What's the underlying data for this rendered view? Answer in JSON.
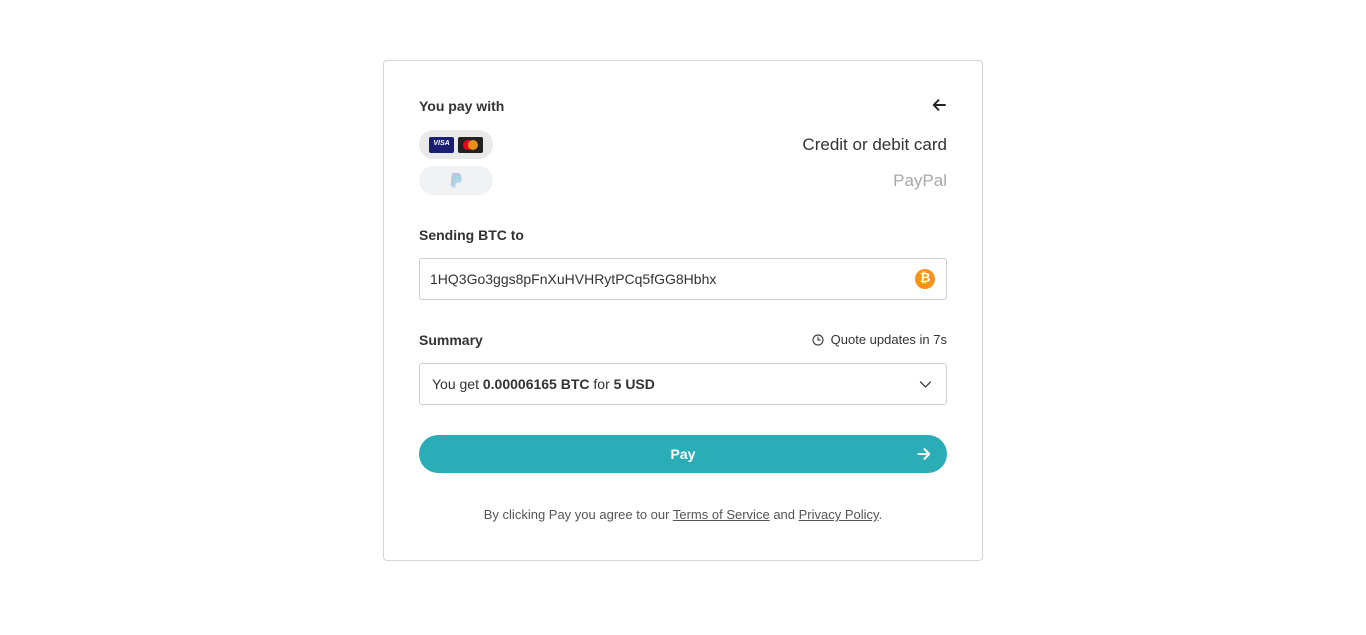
{
  "payment": {
    "title": "You pay with",
    "methods": [
      {
        "label": "Credit or debit card",
        "icons": [
          "visa-icon",
          "mastercard-icon"
        ],
        "selected": true
      },
      {
        "label": "PayPal",
        "icons": [
          "paypal-icon"
        ],
        "selected": false
      }
    ],
    "visa_text": "VISA"
  },
  "sending": {
    "title": "Sending BTC to",
    "address": "1HQ3Go3ggs8pFnXuHVHRytPCq5fGG8Hbhx",
    "coin_icon": "bitcoin-icon",
    "coin_symbol": "₿"
  },
  "summary": {
    "title": "Summary",
    "quote_text": "Quote updates in 7s",
    "you_get_prefix": "You get",
    "amount": "0.00006165 BTC",
    "for_text": "for",
    "fiat": "5 USD"
  },
  "pay_button": {
    "label": "Pay"
  },
  "legal": {
    "prefix": "By clicking Pay you agree to our",
    "terms": "Terms of Service",
    "and": "and",
    "privacy": "Privacy Policy",
    "suffix": "."
  },
  "colors": {
    "accent": "#2aadb7",
    "bitcoin": "#f7931a",
    "visa_bg": "#1a1f71",
    "mastercard_red": "#eb001b",
    "mastercard_orange": "#f79e1b"
  }
}
